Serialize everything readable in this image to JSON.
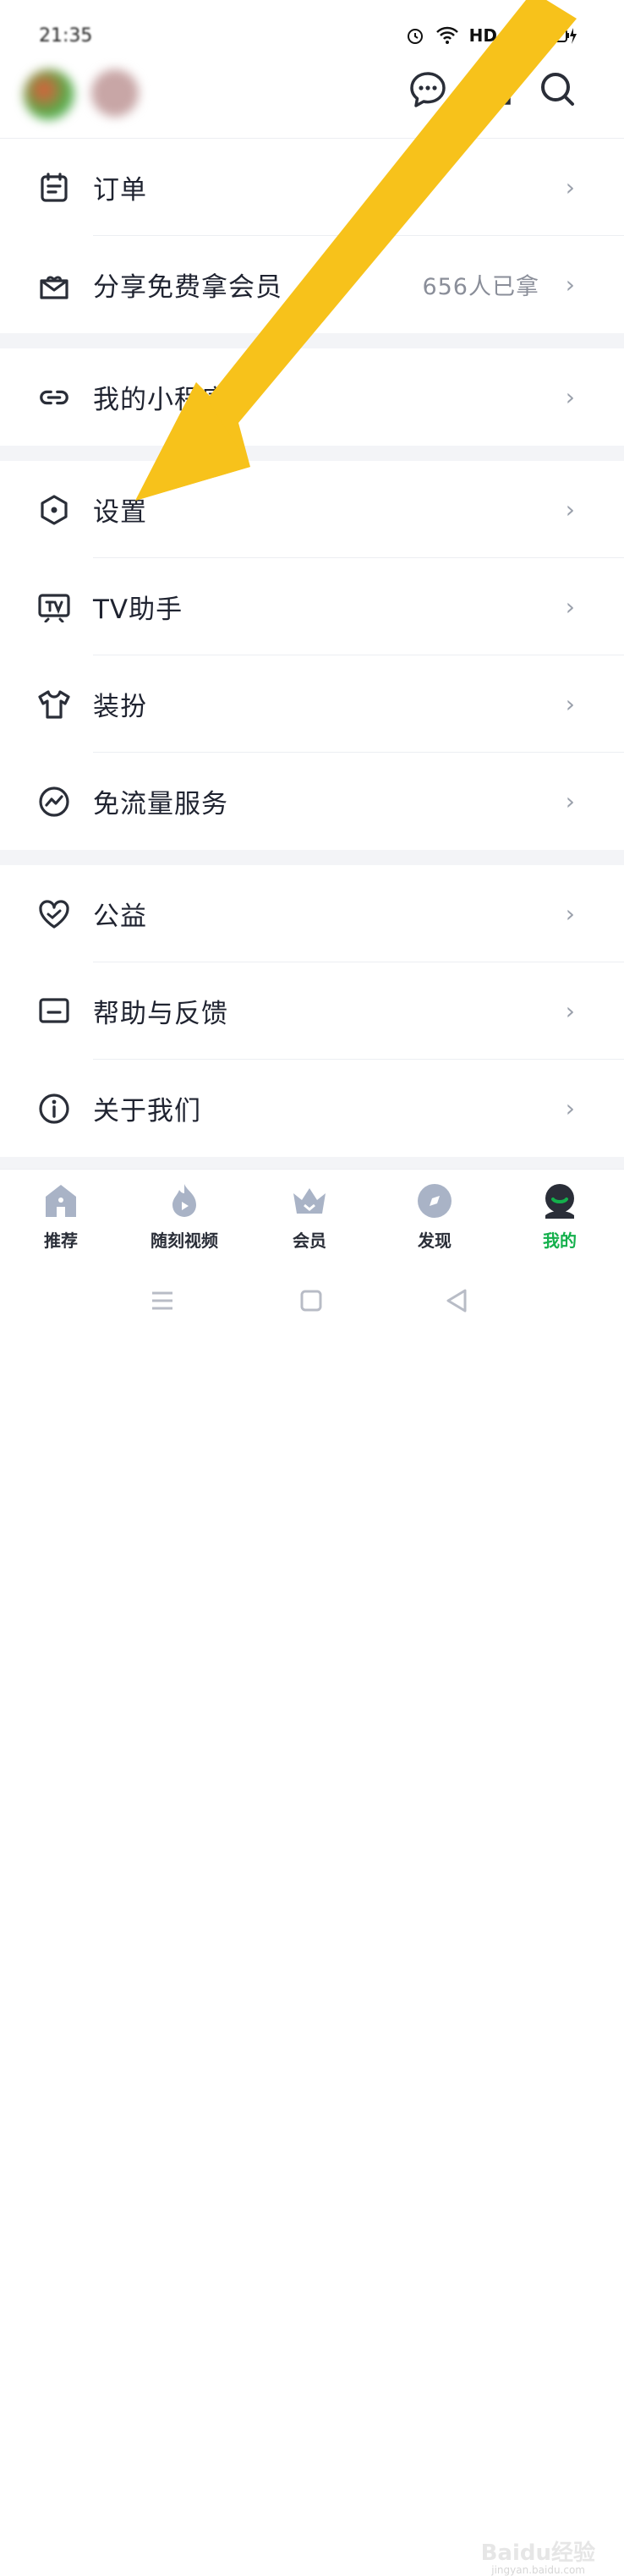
{
  "status_bar": {
    "time": "21:35",
    "network": "HD"
  },
  "header": {
    "icons": [
      "message-icon",
      "scan-icon",
      "search-icon"
    ]
  },
  "menu_sections": [
    [
      {
        "icon": "order-icon",
        "label": "订单",
        "extra": ""
      },
      {
        "icon": "share-gift-icon",
        "label": "分享免费拿会员",
        "extra": "656人已拿"
      }
    ],
    [
      {
        "icon": "mini-program-icon",
        "label": "我的小程序",
        "extra": ""
      }
    ],
    [
      {
        "icon": "settings-icon",
        "label": "设置",
        "extra": ""
      },
      {
        "icon": "tv-icon",
        "label": "TV助手",
        "extra": ""
      },
      {
        "icon": "shirt-icon",
        "label": "装扮",
        "extra": ""
      },
      {
        "icon": "traffic-free-icon",
        "label": "免流量服务",
        "extra": ""
      }
    ],
    [
      {
        "icon": "charity-heart-icon",
        "label": "公益",
        "extra": ""
      },
      {
        "icon": "feedback-icon",
        "label": "帮助与反馈",
        "extra": ""
      },
      {
        "icon": "info-icon",
        "label": "关于我们",
        "extra": ""
      }
    ]
  ],
  "chevron": "›",
  "tabs": [
    {
      "icon": "home-icon",
      "label": "推荐",
      "active": false
    },
    {
      "icon": "flame-video-icon",
      "label": "随刻视频",
      "active": false
    },
    {
      "icon": "crown-icon",
      "label": "会员",
      "active": false
    },
    {
      "icon": "compass-icon",
      "label": "发现",
      "active": false
    },
    {
      "icon": "profile-icon",
      "label": "我的",
      "active": true
    }
  ],
  "colors": {
    "accent_green": "#14b04c",
    "arrow_yellow": "#f7c21b",
    "icon_grey_blue": "#a9b3c6",
    "section_gap": "#f3f4f7"
  },
  "watermark": {
    "text": "Baidu经验",
    "sub": "jingyan.baidu.com"
  }
}
